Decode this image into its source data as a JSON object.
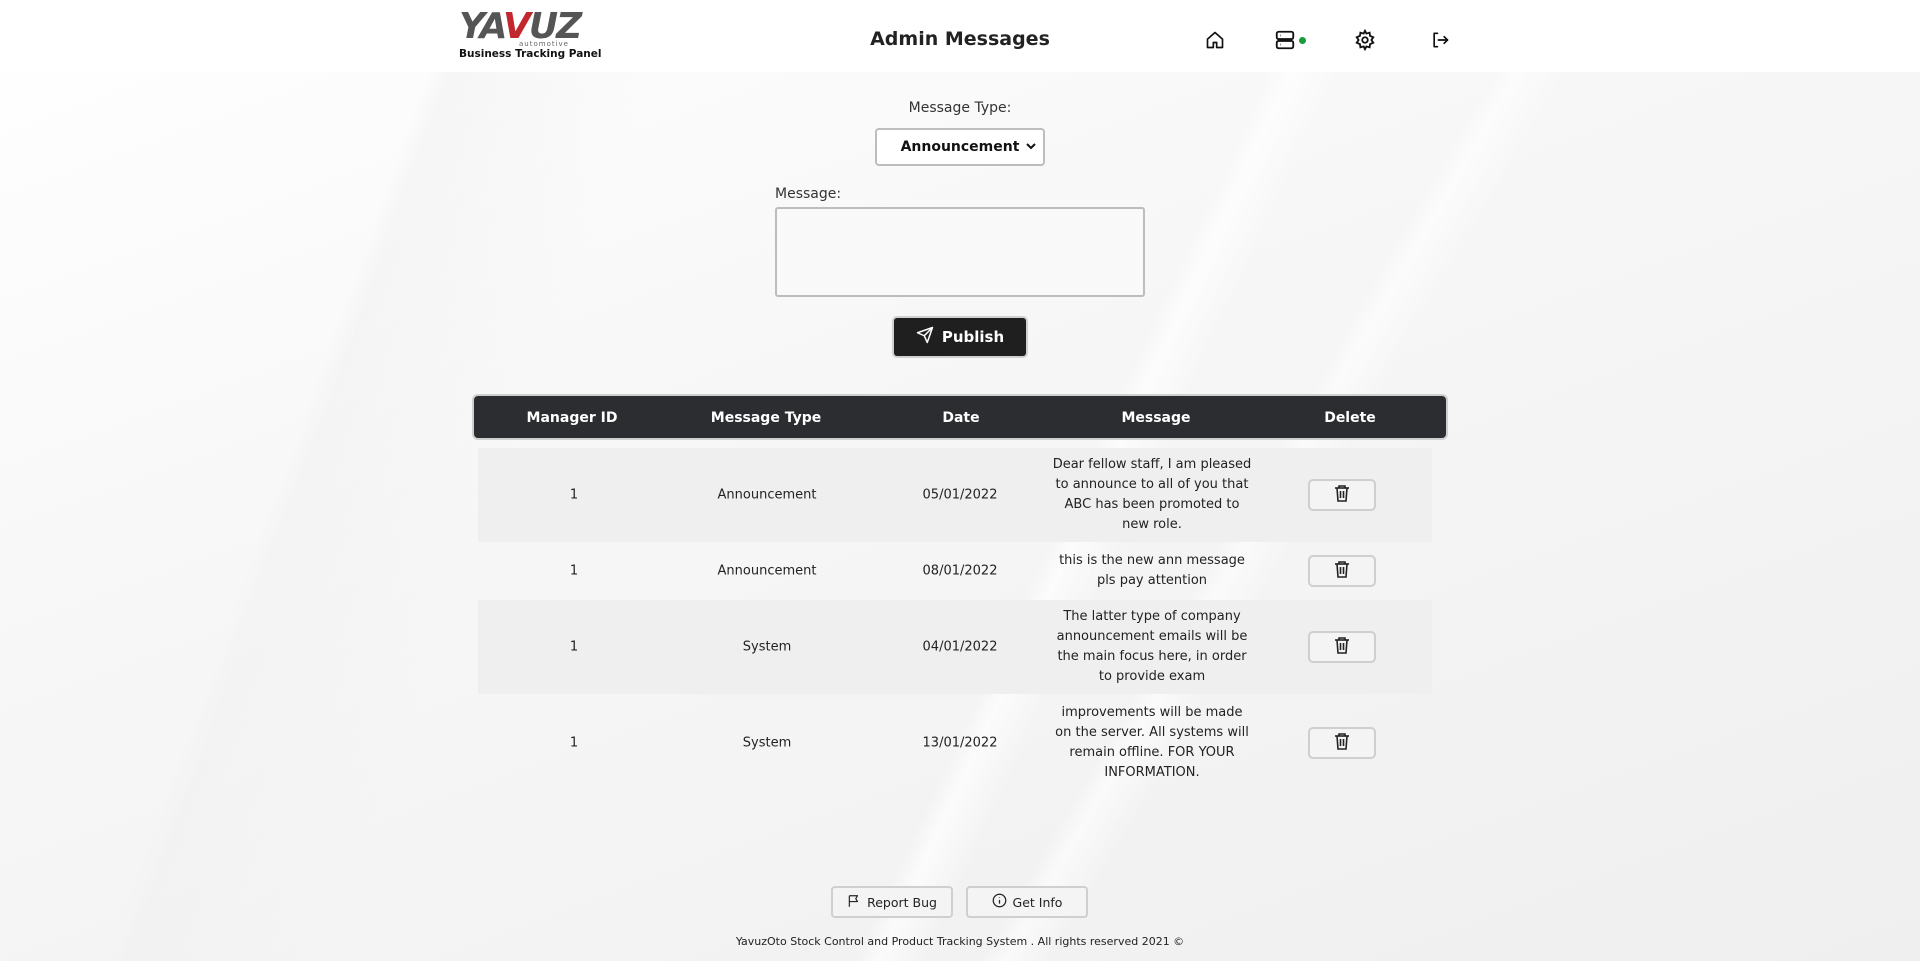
{
  "header": {
    "logo_text": "YAVUZ",
    "logo_sub": "automotive",
    "logo_caption": "Business Tracking Panel",
    "title": "Admin Messages",
    "icons": [
      "home-icon",
      "server-icon",
      "gear-icon",
      "logout-icon"
    ],
    "status_color": "#1a9c3a"
  },
  "form": {
    "type_label": "Message Type:",
    "type_selected": "Announcement",
    "message_label": "Message:",
    "message_value": "",
    "publish_label": "Publish"
  },
  "table": {
    "headers": [
      "Manager ID",
      "Message Type",
      "Date",
      "Message",
      "Delete"
    ],
    "rows": [
      {
        "manager_id": "1",
        "type": "Announcement",
        "date": "05/01/2022",
        "message": "Dear fellow staff, I am pleased to announce to all of you that ABC has been promoted to new role."
      },
      {
        "manager_id": "1",
        "type": "Announcement",
        "date": "08/01/2022",
        "message": "this is the new ann message pls pay attention"
      },
      {
        "manager_id": "1",
        "type": "System",
        "date": "04/01/2022",
        "message": "The latter type of company announcement emails will be the main focus here, in order to provide exam"
      },
      {
        "manager_id": "1",
        "type": "System",
        "date": "13/01/2022",
        "message": "improvements will be made on the server. All systems will remain offline. FOR YOUR INFORMATION."
      }
    ]
  },
  "footer": {
    "report_bug": "Report Bug",
    "get_info": "Get Info",
    "copyright": "YavuzOto Stock Control and Product Tracking System . All rights reserved 2021 ©"
  },
  "colors": {
    "header_bg": "#2b2d30",
    "button_dark": "#1f1f1f",
    "accent_red": "#c1272d"
  }
}
